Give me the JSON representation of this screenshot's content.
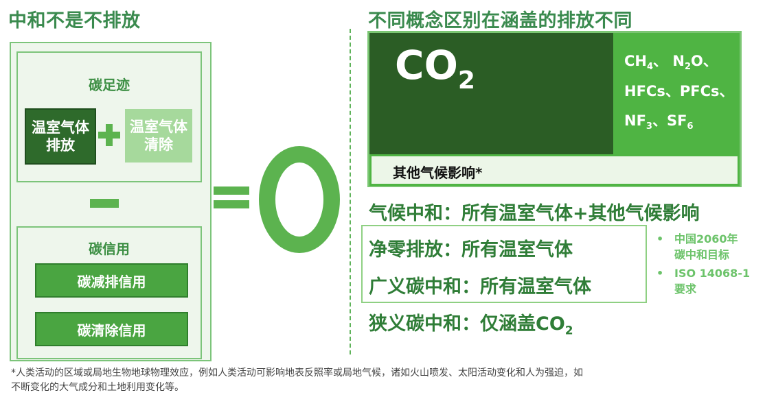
{
  "left": {
    "title": "中和不是不排放",
    "footprint_label": "碳足迹",
    "emission_line1": "温室气体",
    "emission_line2": "排放",
    "removal_line1": "温室气体",
    "removal_line2": "清除",
    "credit_label": "碳信用",
    "reduction_credit": "碳减排信用",
    "removal_credit": "碳清除信用"
  },
  "right": {
    "title": "不同概念区别在涵盖的排放不同",
    "co2_main": "CO",
    "co2_sub": "2",
    "gases": {
      "ch": "CH",
      "ch_sub": "4",
      "sep1": "、",
      "n": "N",
      "n_sub": "2",
      "o": "O、",
      "hfcs": "HFCs、PFCs、",
      "nf": "NF",
      "nf_sub": "3",
      "sf": "、SF",
      "sf_sub": "6"
    },
    "other_effects": "其他气候影响*",
    "climate_neutral": "气候中和：所有温室气体+其他气候影响",
    "net_zero": "净零排放：所有温室气体",
    "broad_carbon_neutral": "广义碳中和：所有温室气体",
    "narrow_carbon_neutral": "狭义碳中和：仅涵盖CO",
    "narrow_sub": "2",
    "notes": [
      {
        "bullet": "•",
        "line1": "中国2060年",
        "line2": "碳中和目标"
      },
      {
        "bullet": "•",
        "line1": "ISO 14068-1",
        "line2": "要求"
      }
    ]
  },
  "footnote": {
    "line1": "*人类活动的区域或局地生物地球物理效应，例如人类活动可影响地表反照率或局地气候，诸如火山喷发、太阳活动变化和人为强迫，如",
    "line2": "不断变化的大气成分和土地利用变化等。"
  },
  "colors": {
    "title_green": "#3a8a4e",
    "dark_green": "#2b5d25",
    "mid_green": "#4fb443",
    "light_green": "#a6d99c"
  }
}
